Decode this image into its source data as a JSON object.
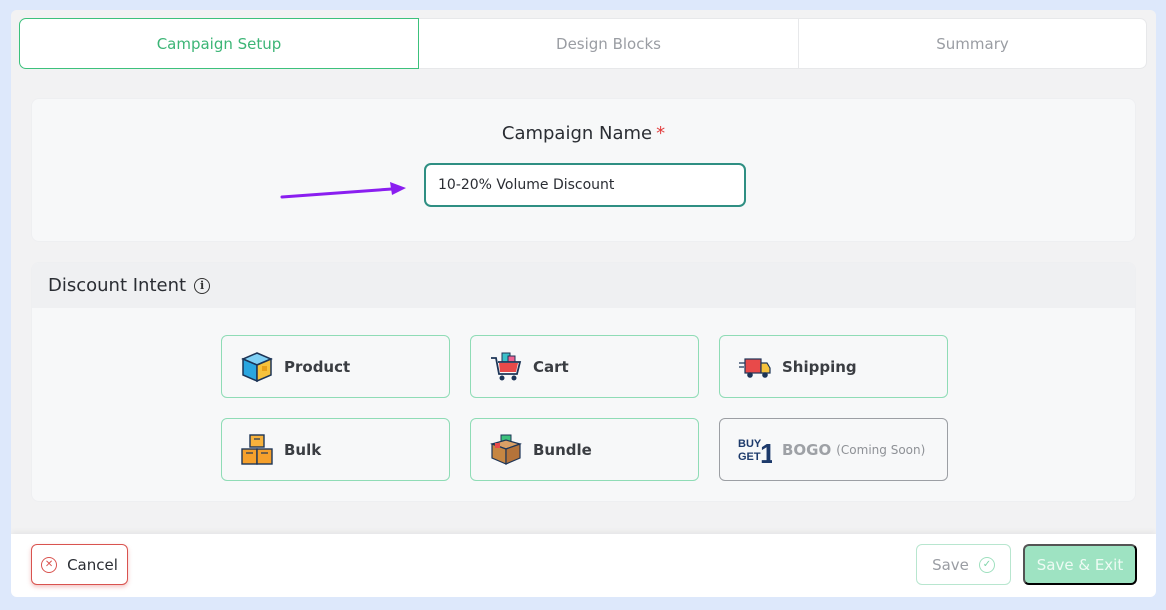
{
  "tabs": [
    {
      "label": "Campaign Setup",
      "active": true
    },
    {
      "label": "Design Blocks",
      "active": false
    },
    {
      "label": "Summary",
      "active": false
    }
  ],
  "campaign": {
    "label": "Campaign Name",
    "required_mark": "*",
    "value": "10-20% Volume Discount"
  },
  "intent": {
    "title": "Discount Intent",
    "info_icon": "info-icon",
    "options": [
      {
        "label": "Product",
        "icon": "product-box-icon"
      },
      {
        "label": "Cart",
        "icon": "shopping-cart-icon"
      },
      {
        "label": "Shipping",
        "icon": "delivery-truck-icon"
      },
      {
        "label": "Bulk",
        "icon": "stacked-boxes-icon"
      },
      {
        "label": "Bundle",
        "icon": "bundle-box-icon"
      },
      {
        "label": "BOGO",
        "note": "(Coming Soon)",
        "icon": "buy-get-1-icon",
        "icon_text": "BUY GET 1",
        "disabled": true
      }
    ]
  },
  "footer": {
    "cancel": "Cancel",
    "save": "Save",
    "save_exit": "Save & Exit"
  },
  "colors": {
    "accent": "#3cc17c",
    "input_border": "#2f8f83",
    "arrow": "#8a1ef0",
    "cancel": "#d9534f",
    "save_exit_bg": "#9ee3c2"
  }
}
